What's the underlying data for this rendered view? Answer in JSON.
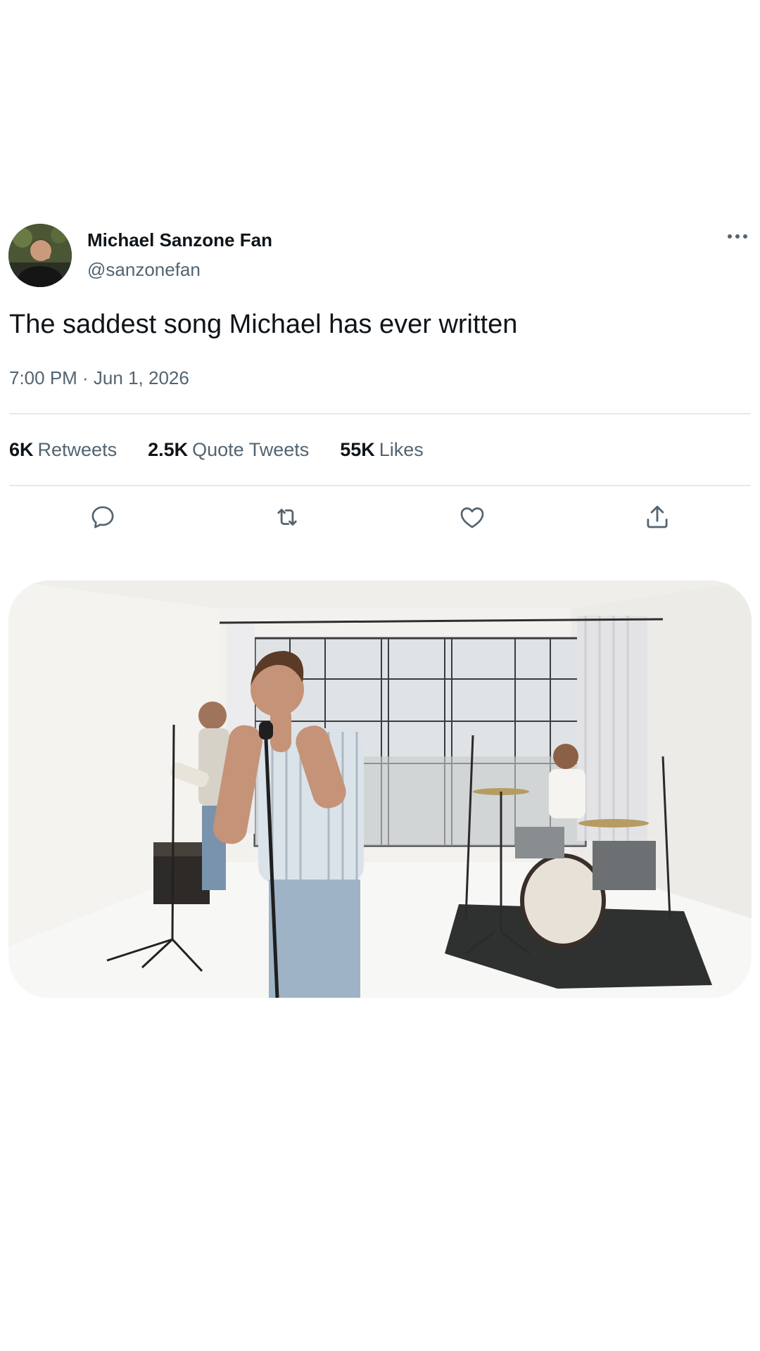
{
  "tweet": {
    "author": {
      "display_name": "Michael Sanzone Fan",
      "handle": "@sanzonefan",
      "avatar_icon": "avatar-photo"
    },
    "text": "The saddest song Michael has ever written",
    "timestamp": "7:00 PM · Jun 1, 2026",
    "stats": {
      "retweets": {
        "count": "6K",
        "label": "Retweets"
      },
      "quote_tweets": {
        "count": "2.5K",
        "label": "Quote Tweets"
      },
      "likes": {
        "count": "55K",
        "label": "Likes"
      }
    },
    "actions": [
      {
        "name": "reply",
        "icon": "reply-icon"
      },
      {
        "name": "retweet",
        "icon": "retweet-icon"
      },
      {
        "name": "like",
        "icon": "heart-icon"
      },
      {
        "name": "share",
        "icon": "share-icon"
      }
    ],
    "media": {
      "type": "video-frame",
      "description_icon": "band-performance-photo"
    }
  },
  "colors": {
    "text_primary": "#0f1419",
    "text_secondary": "#536471",
    "divider": "#e6e9eb",
    "icon": "#536471"
  }
}
